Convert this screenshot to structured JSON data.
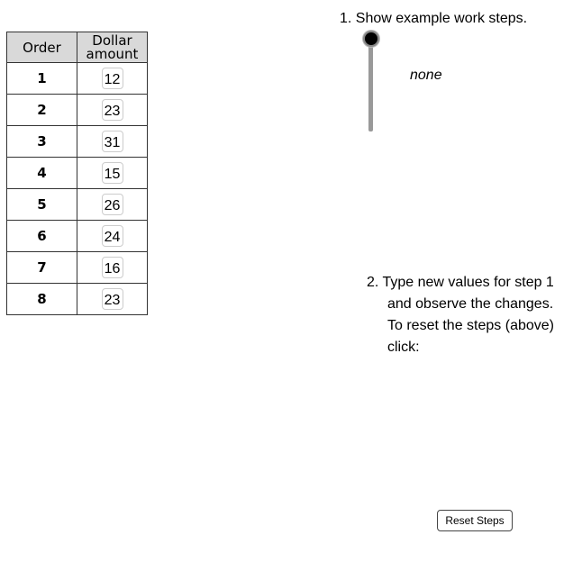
{
  "table": {
    "headers": {
      "order": "Order",
      "dollar_line1": "Dollar",
      "dollar_line2": "amount"
    },
    "rows": [
      {
        "order": "1",
        "amount": "12"
      },
      {
        "order": "2",
        "amount": "23"
      },
      {
        "order": "3",
        "amount": "31"
      },
      {
        "order": "4",
        "amount": "15"
      },
      {
        "order": "5",
        "amount": "26"
      },
      {
        "order": "6",
        "amount": "24"
      },
      {
        "order": "7",
        "amount": "16"
      },
      {
        "order": "8",
        "amount": "23"
      }
    ]
  },
  "step1": {
    "label": "1. Show example work steps.",
    "slider_value_label": "none",
    "slider_position": 0
  },
  "step2": {
    "line1": "2. Type new values for step 1",
    "line2": "and observe the changes.",
    "line3": "To reset the steps (above)",
    "line4": "click:"
  },
  "reset_button": {
    "label": "Reset Steps"
  }
}
